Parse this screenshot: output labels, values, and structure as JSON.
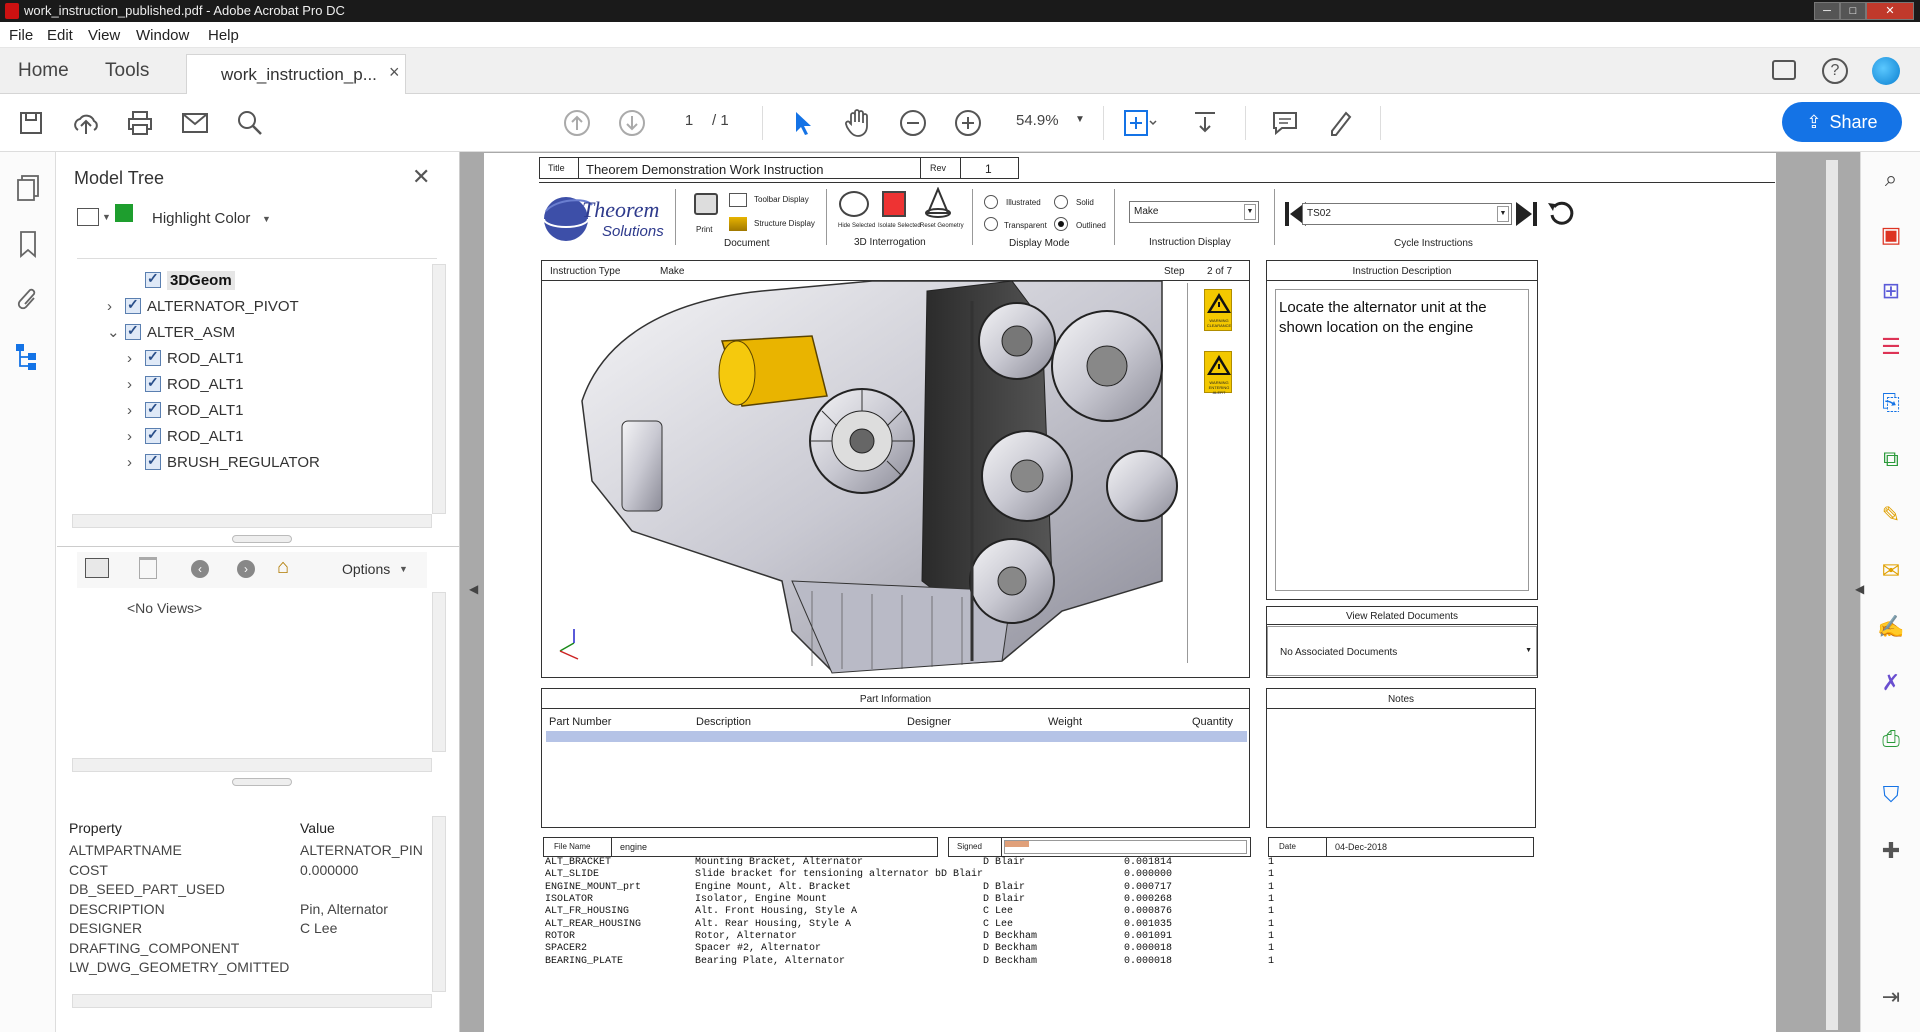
{
  "window": {
    "title": "work_instruction_published.pdf - Adobe Acrobat Pro DC",
    "min": "─",
    "max": "□",
    "close": "✕"
  },
  "menu": [
    "File",
    "Edit",
    "View",
    "Window",
    "Help"
  ],
  "tabs": {
    "home": "Home",
    "tools": "Tools",
    "doc": "work_instruction_p...",
    "doc_close": "×"
  },
  "toolbar": {
    "page_current": "1",
    "page_total": "/ 1",
    "zoom": "54.9%",
    "share": "Share"
  },
  "model_tree": {
    "title": "Model Tree",
    "highlight": "Highlight Color",
    "highlight_color": "#1e9e2e",
    "nodes": [
      {
        "label": "3DGeom",
        "indent": 2,
        "expander": "",
        "selected": true
      },
      {
        "label": "ALTERNATOR_PIVOT",
        "indent": 1,
        "expander": "›"
      },
      {
        "label": "ALTER_ASM",
        "indent": 1,
        "expander": "⌄"
      },
      {
        "label": "ROD_ALT1",
        "indent": 2,
        "expander": "›"
      },
      {
        "label": "ROD_ALT1",
        "indent": 2,
        "expander": "›"
      },
      {
        "label": "ROD_ALT1",
        "indent": 2,
        "expander": "›"
      },
      {
        "label": "ROD_ALT1",
        "indent": 2,
        "expander": "›"
      },
      {
        "label": "BRUSH_REGULATOR",
        "indent": 2,
        "expander": "›"
      }
    ],
    "views_options": "Options",
    "no_views": "<No Views>",
    "prop_header": {
      "property": "Property",
      "value": "Value"
    },
    "properties": [
      {
        "p": "ALTMPARTNAME",
        "v": "ALTERNATOR_PIN"
      },
      {
        "p": "COST",
        "v": "0.000000"
      },
      {
        "p": "DB_SEED_PART_USED",
        "v": ""
      },
      {
        "p": "DESCRIPTION",
        "v": "Pin, Alternator"
      },
      {
        "p": "DESIGNER",
        "v": "C Lee"
      },
      {
        "p": "DRAFTING_COMPONENT",
        "v": ""
      },
      {
        "p": "LW_DWG_GEOMETRY_OMITTED",
        "v": ""
      }
    ]
  },
  "doc": {
    "title_label": "Title",
    "title_value": "Theorem Demonstration Work Instruction",
    "rev_label": "Rev",
    "rev_value": "1",
    "logo_line1": "Theorem",
    "logo_line2": "Solutions",
    "print": "Print",
    "toolbar_display": "Toolbar Display",
    "structure_display": "Structure Display",
    "document_group": "Document",
    "hide_selected": "Hide Selected",
    "isolate_selected": "Isolate Selected",
    "reset_geometry": "Reset Geometry",
    "interrogation_group": "3D Interrogation",
    "illustrated": "Illustrated",
    "solid": "Solid",
    "transparent": "Transparent",
    "outlined": "Outlined",
    "display_mode_group": "Display Mode",
    "instruction_display_value": "Make",
    "instruction_display_group": "Instruction Display",
    "cycle_value": "TS02",
    "cycle_group": "Cycle Instructions",
    "instruction_type_label": "Instruction Type",
    "instruction_type_value": "Make",
    "step_label": "Step",
    "step_value": "2 of 7",
    "desc_header": "Instruction Description",
    "desc_text": "Locate the alternator unit at the shown location on the engine",
    "related_header": "View Related Documents",
    "related_value": "No Associated Documents",
    "part_info_header": "Part Information",
    "notes_header": "Notes",
    "warning1": "WARNING CLEARANCE",
    "warning2": "WARNING ENTERING ALERT",
    "parts_columns": [
      "Part Number",
      "Description",
      "Designer",
      "Weight",
      "Quantity"
    ],
    "parts": [
      [
        "ALT_BRACKET",
        "Mounting Bracket, Alternator",
        "D Blair",
        "0.001814",
        "1"
      ],
      [
        "ALT_SLIDE",
        "Slide bracket for tensioning alternator bD Blair",
        "",
        "0.000000",
        "1"
      ],
      [
        "ENGINE_MOUNT_prt",
        "Engine Mount, Alt. Bracket",
        "D Blair",
        "0.000717",
        "1"
      ],
      [
        "ISOLATOR",
        "Isolator, Engine Mount",
        "D Blair",
        "0.000268",
        "1"
      ],
      [
        "ALT_FR_HOUSING",
        "Alt. Front Housing, Style A",
        "C Lee",
        "0.000876",
        "1"
      ],
      [
        "ALT_REAR_HOUSING",
        "Alt. Rear Housing, Style A",
        "C Lee",
        "0.001035",
        "1"
      ],
      [
        "ROTOR",
        "Rotor, Alternator",
        "D Beckham",
        "0.001091",
        "1"
      ],
      [
        "SPACER2",
        "Spacer #2, Alternator",
        "D Beckham",
        "0.000018",
        "1"
      ],
      [
        "BEARING_PLATE",
        "Bearing Plate, Alternator",
        "D Beckham",
        "0.000018",
        "1"
      ]
    ],
    "file_name_label": "File Name",
    "file_name_value": "engine",
    "signed_label": "Signed",
    "date_label": "Date",
    "date_value": "04-Dec-2018"
  }
}
